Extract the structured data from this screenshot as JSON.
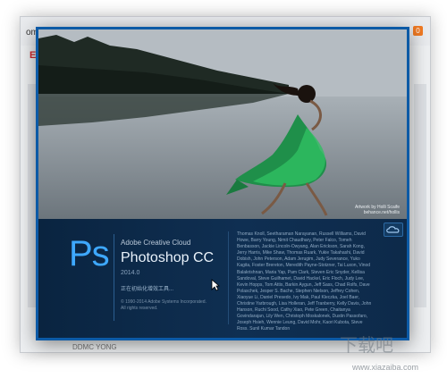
{
  "background_window": {
    "url_fragment": "om.",
    "red_mark": "E",
    "corner_icon": "0",
    "bottom_text": "DDMC YONG"
  },
  "splash": {
    "photo_credit": "Artwork by Holli Scaife\nbehance.net/hollis",
    "logo": "Ps",
    "family": "Adobe Creative Cloud",
    "product": "Photoshop CC",
    "version": "2014.0",
    "status": "正在初始化增效工具...",
    "copyright": "© 1990-2014 Adobe Systems Incorporated. All rights reserved.",
    "credits": "Thomas Knoll, Seetharaman Narayanan, Russell Williams, David Howe, Barry Young, Nimit Chaudhary, Peter Falco, Tomeh Benbasson, Jackie Lincoln-Owyang, Alan Erickson, Sarah Kong, Jerry Harris, Mike Shaw, Thomas Ruark, Yukie Takahashi, David Dobish, John Peterson, Adam Jerugim, Judy Severance, Yuko Kagita, Foster Brereton, Meredith Payne-Stotzner, Tai Luxon, Vinod Balakrishnan, Maria Yap, Pam Clark, Steven Eric Snyder, Kellisa Sandoval, Steve Guilhamet, David Hackel, Eric Floch, Judy Lee, Kevin Hopps, Tom Attix, Barkin Aygun, Jeff Sass, Chad Rolfs, Dave Polaschek, Jesper S. Bache, Stephen Nielson, Jeffrey Cohen, Xiaoyue Li, Daniel Presedo, Ivy Mak, Paul Kleczka, Joel Baer, Christine Yarbrough, Lisa Holleran, Jeff Tranberry, Kelly Davis, John Hanson, Ruchi Sood, Cathy Xiao, Pete Green, Chaitanya Govindarajan, Lily Wen, Christoph Moskalonek, Dustin Passofaro, Joseph Hsieh, Wennie Leung, David Mohr, Kaori Kubota, Steve Ross, Sunil Kumar Tandon",
    "cc_icon": "creative-cloud-icon"
  },
  "watermark": {
    "logo_text": "下载吧",
    "url": "www.xiazaiba.com"
  },
  "colors": {
    "accent": "#3ea8ff",
    "splash_border": "#0c5aa6",
    "banner_bg": "#0f2f52"
  }
}
